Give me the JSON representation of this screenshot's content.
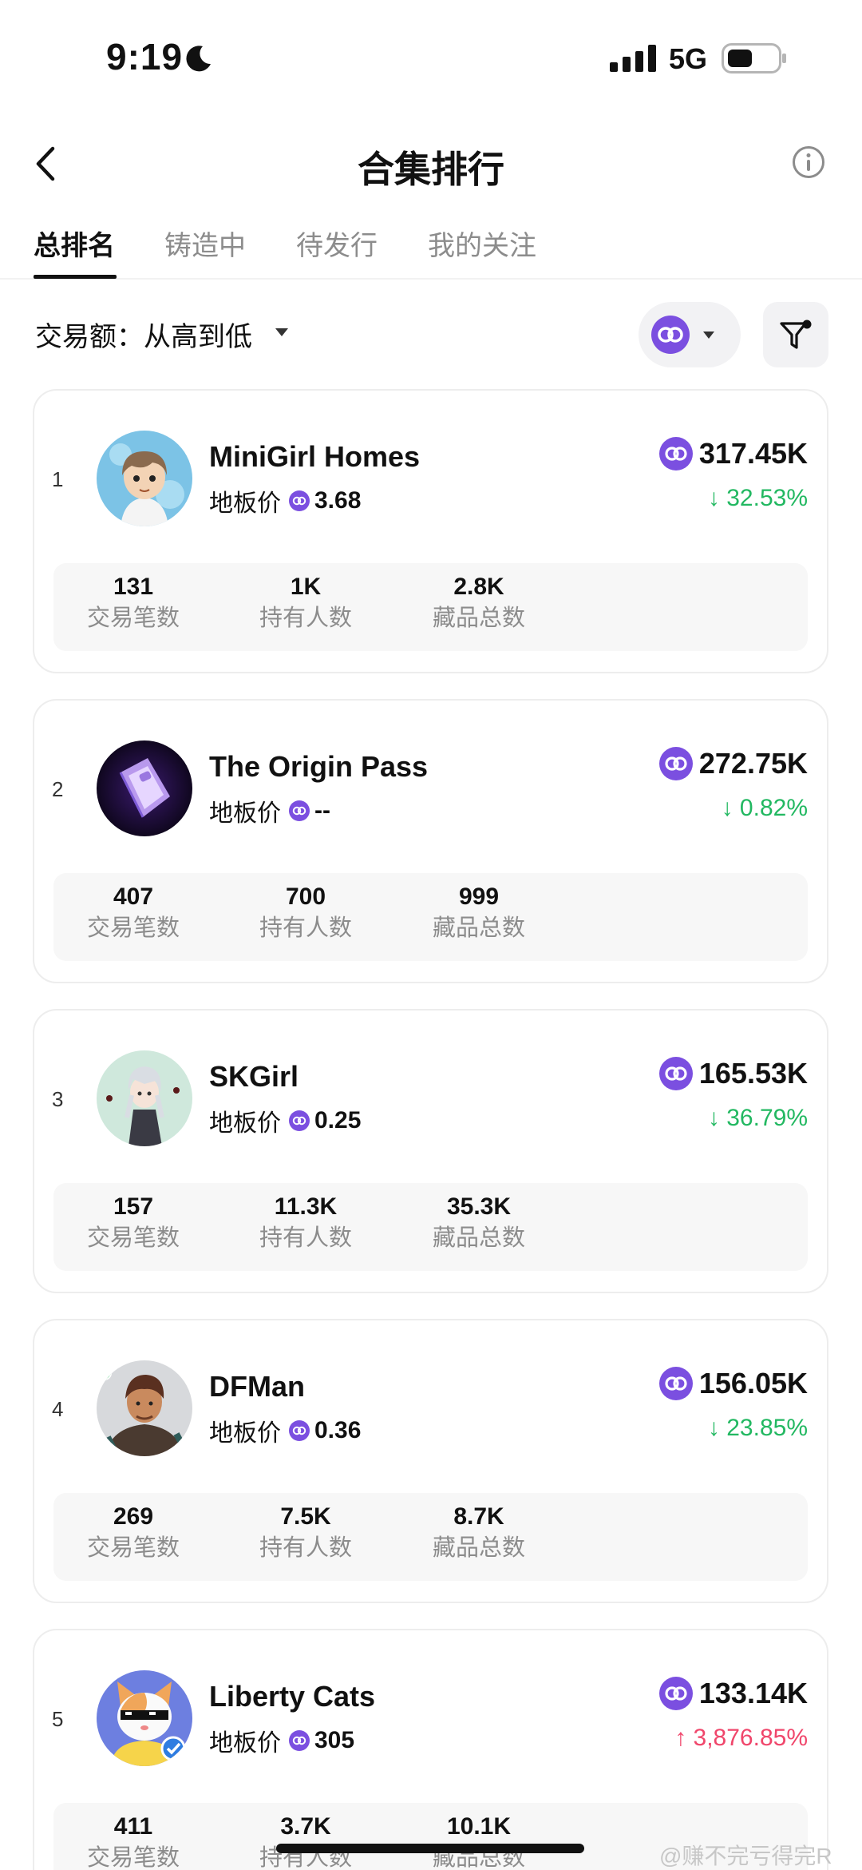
{
  "status_bar": {
    "time": "9:19",
    "network": "5G"
  },
  "nav": {
    "title": "合集排行"
  },
  "tabs": [
    {
      "label": "总排名",
      "active": true
    },
    {
      "label": "铸造中",
      "active": false
    },
    {
      "label": "待发行",
      "active": false
    },
    {
      "label": "我的关注",
      "active": false
    }
  ],
  "sort": {
    "label": "交易额：从高到低"
  },
  "colors": {
    "accent": "#7b4fe0",
    "down": "#22b861",
    "up": "#f0466b"
  },
  "floor_label": "地板价",
  "stat_labels": {
    "trades": "交易笔数",
    "holders": "持有人数",
    "items": "藏品总数"
  },
  "collections": [
    {
      "rank": "1",
      "name": "MiniGirl Homes",
      "floor": "3.68",
      "volume": "317.45K",
      "change": "↓ 32.53%",
      "trend": "down",
      "trades": "131",
      "holders": "1K",
      "items": "2.8K",
      "avatar": "girl-avatar"
    },
    {
      "rank": "2",
      "name": "The Origin Pass",
      "floor": "--",
      "volume": "272.75K",
      "change": "↓ 0.82%",
      "trend": "down",
      "trades": "407",
      "holders": "700",
      "items": "999",
      "avatar": "pass-avatar"
    },
    {
      "rank": "3",
      "name": "SKGirl",
      "floor": "0.25",
      "volume": "165.53K",
      "change": "↓ 36.79%",
      "trend": "down",
      "trades": "157",
      "holders": "11.3K",
      "items": "35.3K",
      "avatar": "anime-girl-avatar"
    },
    {
      "rank": "4",
      "name": "DFMan",
      "floor": "0.36",
      "volume": "156.05K",
      "change": "↓ 23.85%",
      "trend": "down",
      "trades": "269",
      "holders": "7.5K",
      "items": "8.7K",
      "avatar": "soldier-avatar"
    },
    {
      "rank": "5",
      "name": "Liberty Cats",
      "floor": "305",
      "volume": "133.14K",
      "change": "↑ 3,876.85%",
      "trend": "up",
      "trades": "411",
      "holders": "3.7K",
      "items": "10.1K",
      "avatar": "cat-avatar"
    }
  ],
  "watermark": "@赚不完亏得完R"
}
